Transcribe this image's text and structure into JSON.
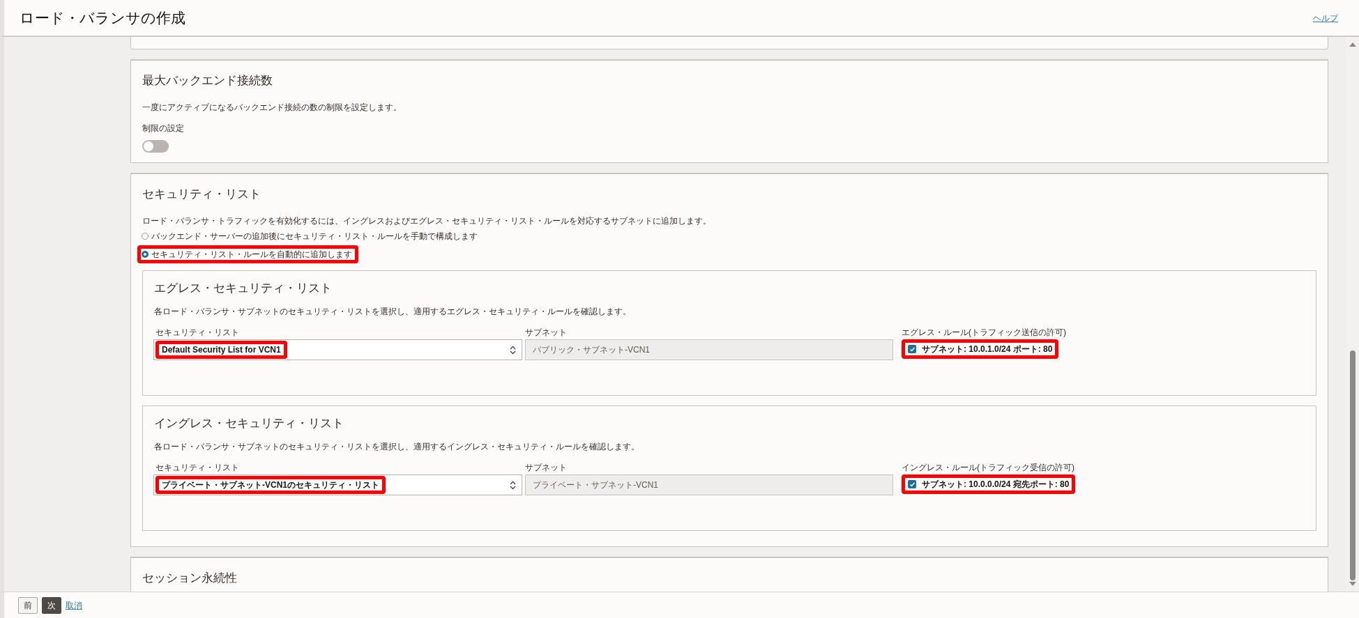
{
  "header": {
    "title": "ロード・バランサの作成",
    "help_link": "ヘルプ"
  },
  "max_connections": {
    "title": "最大バックエンド接続数",
    "description": "一度にアクティブになるバックエンド接続の数の制限を設定します。",
    "toggle_label": "制限の設定",
    "on": false
  },
  "security_list": {
    "title": "セキュリティ・リスト",
    "description": "ロード・バランサ・トラフィックを有効化するには、イングレスおよびエグレス・セキュリティ・リスト・ルールを対応するサブネットに追加します。",
    "options": [
      {
        "label": "バックエンド・サーバーの追加後にセキュリティ・リスト・ルールを手動で構成します",
        "selected": false,
        "highlighted": false
      },
      {
        "label": "セキュリティ・リスト・ルールを自動的に追加します",
        "selected": true,
        "highlighted": true
      }
    ],
    "subsections": [
      {
        "title": "エグレス・セキュリティ・リスト",
        "description": "各ロード・バランサ・サブネットのセキュリティ・リストを選択し、適用するエグレス・セキュリティ・ルールを確認します。",
        "list_label": "セキュリティ・リスト",
        "list_value": "Default Security List for VCN1",
        "list_highlighted": true,
        "subnet_label": "サブネット",
        "subnet_value": "パブリック・サブネット-VCN1",
        "rule_label": "エグレス・ルール(トラフィック送信の許可)",
        "rule": "サブネット: 10.0.1.0/24 ポート: 80",
        "rule_checked": true,
        "rule_highlighted": true
      },
      {
        "title": "イングレス・セキュリティ・リスト",
        "description": "各ロード・バランサ・サブネットのセキュリティ・リストを選択し、適用するイングレス・セキュリティ・ルールを確認します。",
        "list_label": "セキュリティ・リスト",
        "list_value": "プライベート・サブネット-VCN1のセキュリティ・リスト",
        "list_highlighted": true,
        "subnet_label": "サブネット",
        "subnet_value": "プライベート・サブネット-VCN1",
        "rule_label": "イングレス・ルール(トラフィック受信の許可)",
        "rule": "サブネット: 10.0.0.0/24 宛先ポート: 80",
        "rule_checked": true,
        "rule_highlighted": true
      }
    ]
  },
  "session": {
    "title": "セッション永続性"
  },
  "footer": {
    "buttons": [
      {
        "label": "前",
        "kind": "secondary"
      },
      {
        "label": "次",
        "kind": "primary"
      }
    ],
    "cancel_link": "取消"
  }
}
